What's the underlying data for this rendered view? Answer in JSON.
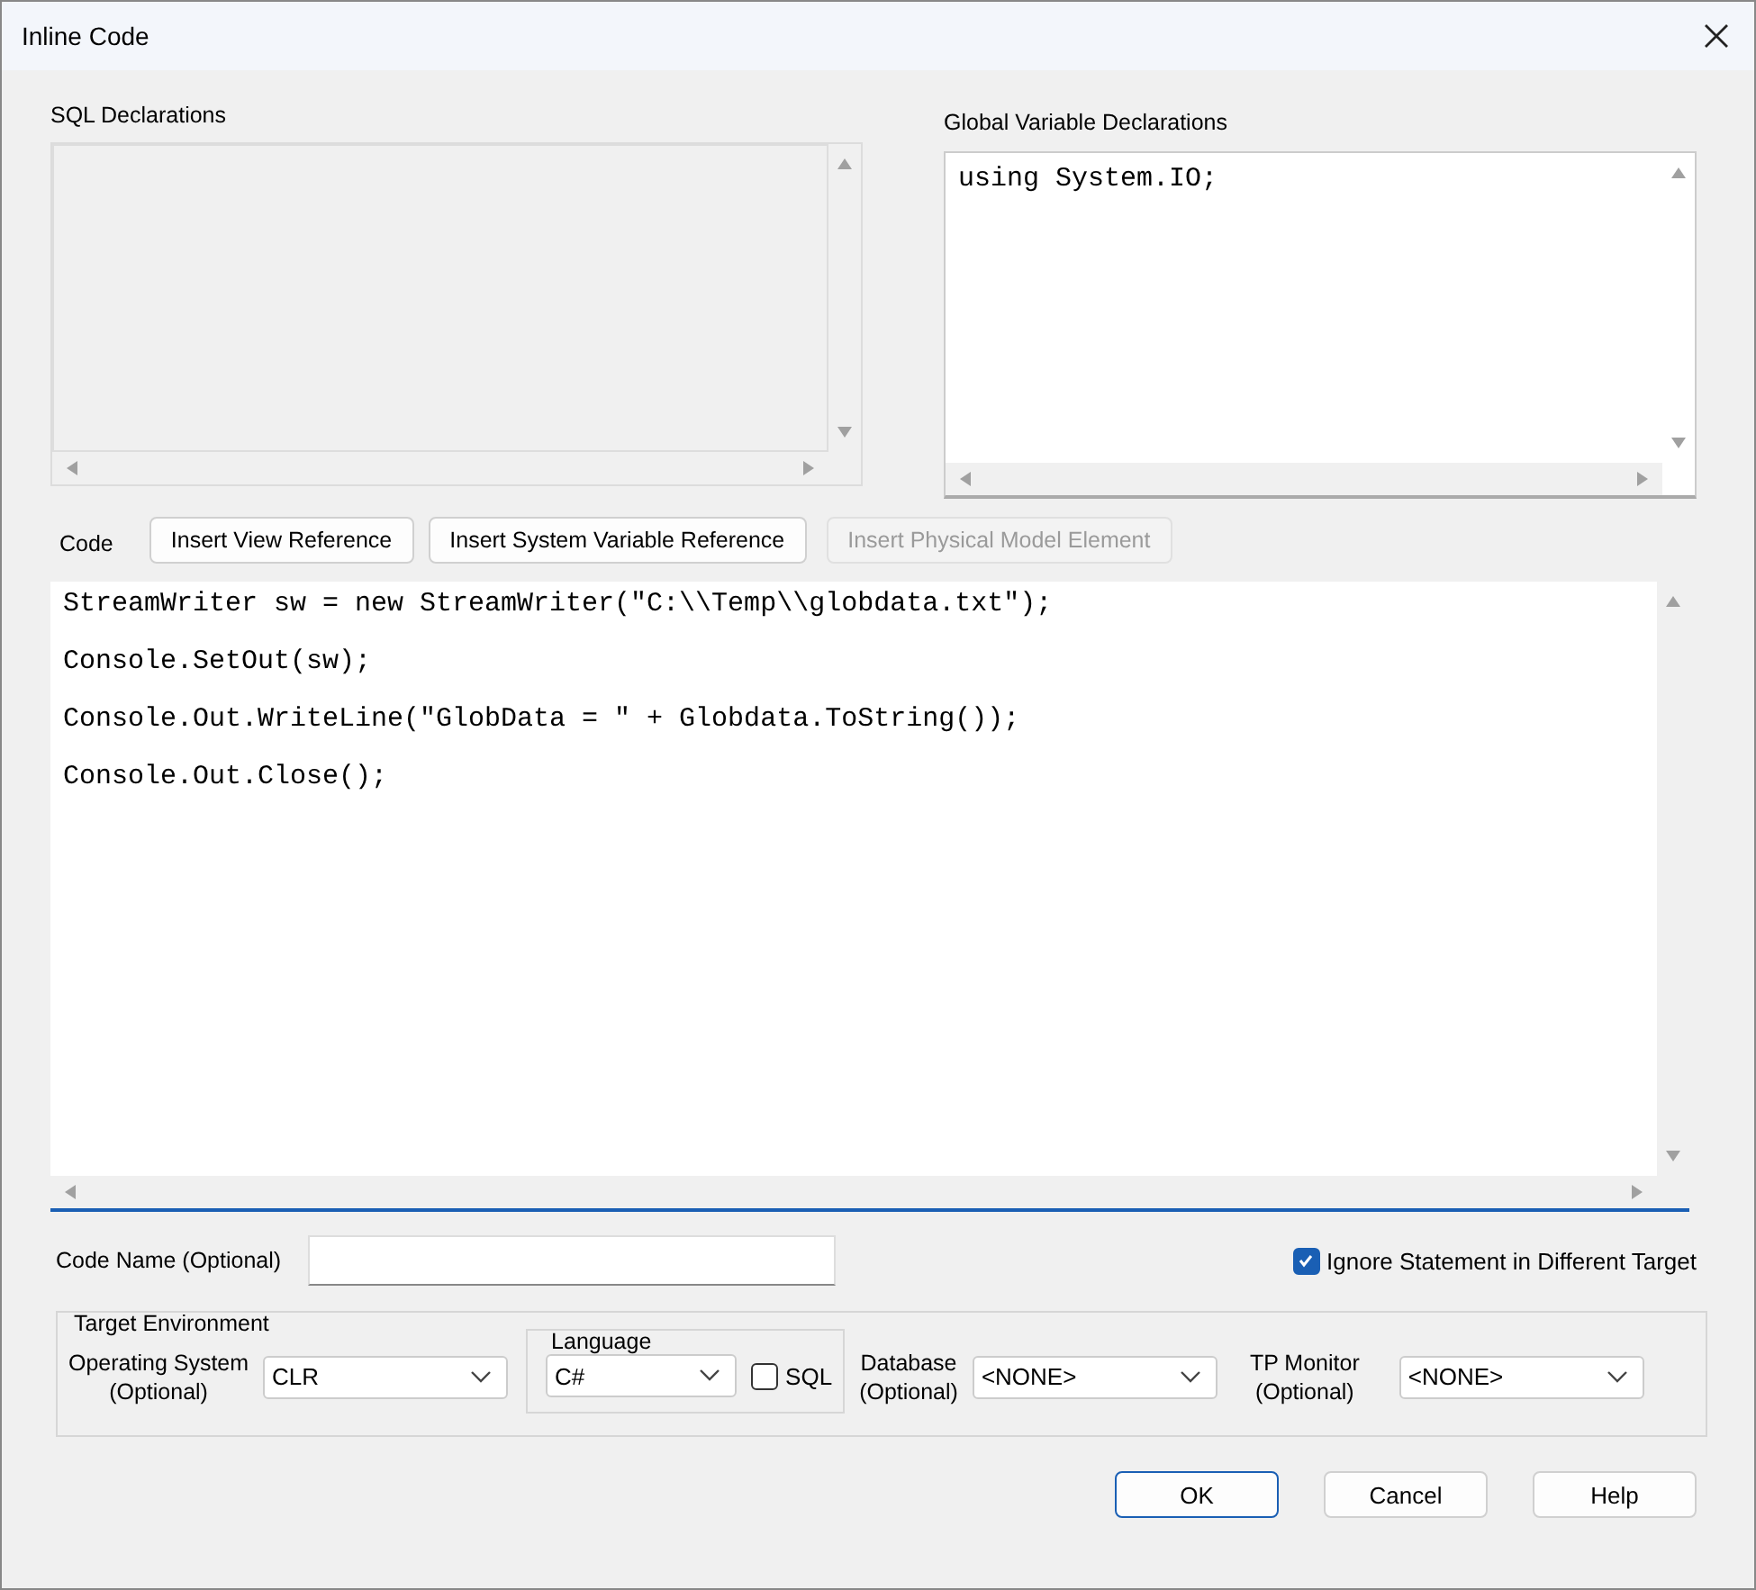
{
  "window": {
    "title": "Inline Code"
  },
  "sql_declarations": {
    "label": "SQL Declarations",
    "disabled": true
  },
  "global_declarations": {
    "label": "Global Variable Declarations",
    "lines": [
      "using System.IO;"
    ]
  },
  "code": {
    "label": "Code",
    "buttons": [
      {
        "label": "Insert View Reference",
        "disabled": false
      },
      {
        "label": "Insert System Variable Reference",
        "disabled": false
      },
      {
        "label": "Insert Physical Model Element",
        "disabled": true
      }
    ],
    "lines": [
      "StreamWriter sw = new StreamWriter(\"C:\\\\Temp\\\\globdata.txt\");",
      "Console.SetOut(sw);",
      "Console.Out.WriteLine(\"GlobData = \" + Globdata.ToString());",
      "Console.Out.Close();"
    ]
  },
  "code_name": {
    "label": "Code Name (Optional)"
  },
  "ignore_statement": {
    "label": "Ignore Statement in Different Target",
    "checked": true
  },
  "target_environment": {
    "title": "Target Environment",
    "operating_system": {
      "label": [
        "Operating System",
        "(Optional)"
      ],
      "value": "CLR"
    },
    "language": {
      "title": "Language",
      "value": "C#",
      "sql": {
        "label": "SQL",
        "checked": false
      }
    },
    "database": {
      "label": [
        "Database",
        "(Optional)"
      ],
      "value": "<NONE>"
    },
    "tp_monitor": {
      "label": [
        "TP Monitor",
        "(Optional)"
      ],
      "value": "<NONE>"
    }
  },
  "buttons": [
    {
      "label": "OK",
      "default": true
    },
    {
      "label": "Cancel",
      "default": false
    },
    {
      "label": "Help",
      "default": false
    }
  ]
}
